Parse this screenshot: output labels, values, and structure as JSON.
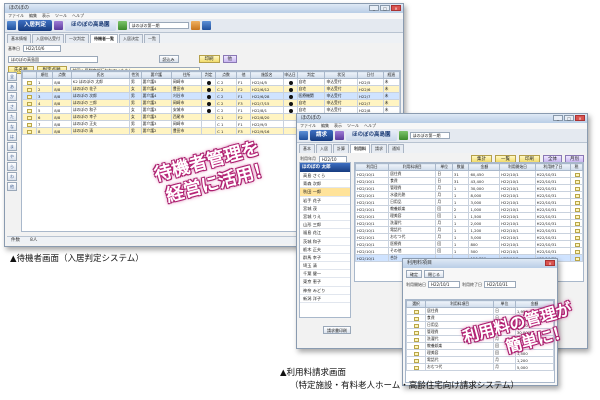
{
  "win1": {
    "title_badge": "入居判定",
    "facility": "ほのぼの高島園",
    "menu": [
      "ファイル",
      "編集",
      "表示",
      "ツール",
      "ヘルプ"
    ],
    "window_title": "ほのぼの",
    "selector": "ほのぼの第一期",
    "tabs": [
      "基本情報",
      "入居申込受付",
      "一次判定",
      "待機者一覧",
      "入居決定",
      "一覧"
    ],
    "active_tab": "待機者一覧",
    "date_label": "基準日",
    "date_value": "H22/10/6",
    "facility_field": "ほのぼの高島園",
    "search_btn": "読込み",
    "print_btn": "印刷",
    "other_btn": "他",
    "left_tabs": [
      "氏名順",
      "判定点順"
    ],
    "note": "前回入居判定が行われていません。",
    "columns": [
      "",
      "順位",
      "点数",
      "氏名",
      "性別",
      "要介護",
      "住所",
      "判定",
      "点数",
      "他",
      "施設名",
      "申込日",
      "判定",
      "状況",
      "日付",
      "経過"
    ],
    "rows": [
      [
        "",
        "1",
        "8/8",
        "K2 ほのぼの 太郎",
        "男",
        "要介護5",
        "岡崎市",
        "●",
        "C 2",
        "F1",
        "H22/4/5",
        "●",
        "自宅",
        "申込受付",
        "H22/5",
        "未"
      ],
      [
        "",
        "2",
        "8/8",
        "ほのぼの 花子",
        "女",
        "要介護4",
        "豊田市",
        "●",
        "C 2",
        "F2",
        "H22/6/12",
        "●",
        "自宅",
        "申込受付",
        "H22/6",
        "未"
      ],
      [
        "",
        "3",
        "8/8",
        "ほのぼの 次郎",
        "男",
        "要介護4",
        "刈谷市",
        "●",
        "C 2",
        "F1",
        "H22/6/28",
        "●",
        "医療機関",
        "申込受付",
        "H22/7",
        "未"
      ],
      [
        "",
        "4",
        "8/8",
        "ほのぼの 三郎",
        "男",
        "要介護3",
        "岡崎市",
        "●",
        "C 2",
        "F3",
        "H22/7/15",
        "●",
        "自宅",
        "申込受付",
        "H22/7",
        "未"
      ],
      [
        "",
        "5",
        "8/8",
        "ほのぼの 和子",
        "女",
        "要介護3",
        "安城市",
        "●",
        "C 2",
        "F1",
        "H22/8/1",
        "●",
        "自宅",
        "申込受付",
        "H22/8",
        "未"
      ],
      [
        "",
        "6",
        "8/8",
        "ほのぼの 幸子",
        "女",
        "要介護3",
        "西尾市",
        "",
        "C 1",
        "F2",
        "H22/8/20",
        "",
        "老健",
        "申込受付",
        "H22/8",
        "未"
      ],
      [
        "",
        "7",
        "8/8",
        "ほのぼの 正夫",
        "男",
        "要介護3",
        "岡崎市",
        "",
        "C 1",
        "F1",
        "H22/9/3",
        "",
        "自宅",
        "申込受付",
        "H22/9",
        "未"
      ],
      [
        "",
        "8",
        "8/8",
        "ほのぼの 清",
        "男",
        "要介護2",
        "豊田市",
        "",
        "C 1",
        "F3",
        "H22/9/16",
        "",
        "老健",
        "申込受付",
        "H22/9",
        "未"
      ]
    ],
    "left_buttons": [
      "全",
      "あ",
      "か",
      "さ",
      "た",
      "な",
      "は",
      "ま",
      "や",
      "ら",
      "わ",
      "他"
    ],
    "status_left": "件数",
    "status_right": "8人"
  },
  "win2": {
    "title_badge": "請求",
    "facility": "ほのぼの高島園",
    "menu": [
      "ファイル",
      "編集",
      "表示",
      "ツール",
      "ヘルプ"
    ],
    "window_title": "ほのぼの",
    "selector": "ほのぼの第一期",
    "tabs": [
      "基本",
      "入居",
      "計算",
      "利用料",
      "請求",
      "通知"
    ],
    "active_tab": "利用料",
    "date_label": "利用年月",
    "date_value": "H22/10",
    "buttons": [
      "集計",
      "一覧",
      "印刷",
      "全体",
      "月別"
    ],
    "sidebar_head": "ほのぼの 太郎",
    "sidebar_items": [
      "高島 さくら",
      "青森 次郎",
      "秋田 一郎",
      "岩手 花子",
      "宮城 茂",
      "宮城 りえ",
      "山形 三郎",
      "福島 花江",
      "茨城 和子",
      "栃木 正夫",
      "群馬 幸子",
      "埼玉 清",
      "千葉 健一",
      "東京 恵子",
      "神奈 みどり",
      "新潟 洋子"
    ],
    "active_sidebar": "秋田 一郎",
    "columns": [
      "利用日",
      "利用料項目",
      "単位",
      "数量",
      "金額",
      "利用開始日",
      "利用終了日",
      "税"
    ],
    "rows": [
      [
        "H22/10/1",
        "居住費",
        "日",
        "31",
        "60,450",
        "H22/10/1",
        "H22/10/31",
        ""
      ],
      [
        "H22/10/1",
        "食費",
        "日",
        "31",
        "43,400",
        "H22/10/1",
        "H22/10/31",
        ""
      ],
      [
        "H22/10/1",
        "管理費",
        "月",
        "1",
        "30,000",
        "H22/10/1",
        "H22/10/31",
        ""
      ],
      [
        "H22/10/1",
        "水道光熱",
        "月",
        "1",
        "8,000",
        "H22/10/1",
        "H22/10/31",
        ""
      ],
      [
        "H22/10/1",
        "日用品",
        "月",
        "1",
        "3,000",
        "H22/10/1",
        "H22/10/31",
        ""
      ],
      [
        "H22/10/1",
        "教養娯楽",
        "回",
        "2",
        "1,000",
        "H22/10/1",
        "H22/10/31",
        ""
      ],
      [
        "H22/10/1",
        "理美容",
        "回",
        "1",
        "1,500",
        "H22/10/1",
        "H22/10/31",
        ""
      ],
      [
        "H22/10/1",
        "洗濯代",
        "月",
        "1",
        "2,000",
        "H22/10/1",
        "H22/10/31",
        ""
      ],
      [
        "H22/10/1",
        "電話代",
        "月",
        "1",
        "1,200",
        "H22/10/1",
        "H22/10/31",
        ""
      ],
      [
        "H22/10/1",
        "おむつ代",
        "月",
        "1",
        "5,000",
        "H22/10/1",
        "H22/10/31",
        ""
      ],
      [
        "H22/10/1",
        "医療費",
        "回",
        "1",
        "800",
        "H22/10/1",
        "H22/10/31",
        ""
      ],
      [
        "H22/10/1",
        "その他",
        "回",
        "1",
        "500",
        "H22/10/1",
        "H22/10/31",
        ""
      ],
      [
        "H22/10/1",
        "合計",
        "",
        "",
        "156,850",
        "H22/10/1",
        "H22/10/31",
        ""
      ]
    ],
    "footer_btn": "請求書印刷"
  },
  "win3": {
    "title": "利用料項目",
    "buttons": [
      "確定",
      "閉じる"
    ],
    "start_label": "利用開始日",
    "end_label": "利用終了日",
    "start_value": "H22/10/1",
    "end_value": "H22/10/31",
    "columns": [
      "選択",
      "利用料項目",
      "単位",
      "金額"
    ],
    "rows": [
      [
        "",
        "居住費",
        "日",
        "1,950"
      ],
      [
        "",
        "食費",
        "日",
        "1,400"
      ],
      [
        "",
        "日用品",
        "月",
        "3,000"
      ],
      [
        "",
        "管理費",
        "月",
        "30,000"
      ],
      [
        "",
        "洗濯代",
        "月",
        "2,000"
      ],
      [
        "",
        "教養娯楽",
        "回",
        "500"
      ],
      [
        "",
        "理美容",
        "回",
        "1,500"
      ],
      [
        "",
        "電話代",
        "月",
        "1,200"
      ],
      [
        "",
        "おむつ代",
        "月",
        "5,000"
      ]
    ]
  },
  "callouts": {
    "c1_line1": "待機者管理を",
    "c1_line2": "経営に活用！",
    "c2_line1": "利用料の管理が",
    "c2_line2": "簡単に！"
  },
  "captions": {
    "cap1": "▲待機者画面（入居判定システム）",
    "cap2": "▲利用料請求画面",
    "cap3": "（特定施設・有料老人ホーム・高齢住宅向け請求システム）"
  }
}
